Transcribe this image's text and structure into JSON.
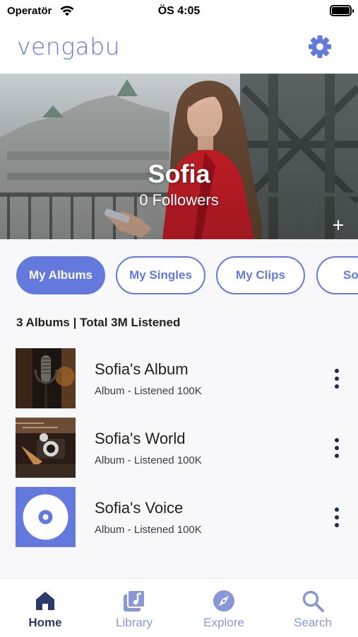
{
  "status_bar": {
    "carrier": "Operatör",
    "time": "ÖS 4:05",
    "wifi_icon": "wifi-icon",
    "battery_icon": "battery-icon"
  },
  "header": {
    "logo": "vengabu",
    "settings_icon": "gear-icon"
  },
  "profile": {
    "name": "Sofia",
    "followers": "0 Followers",
    "add_icon": "plus-icon"
  },
  "tabs": [
    {
      "label": "My Albums",
      "active": true
    },
    {
      "label": "My Singles",
      "active": false
    },
    {
      "label": "My Clips",
      "active": false
    },
    {
      "label": "So",
      "active": false
    }
  ],
  "summary": "3 Albums | Total 3M Listened",
  "albums": [
    {
      "title": "Sofia's Album",
      "meta": "Album  -  Listened 100K",
      "cover": "studio-microphone"
    },
    {
      "title": "Sofia's World",
      "meta": "Album  -  Listened 100K",
      "cover": "vintage-camera"
    },
    {
      "title": "Sofia's Voice",
      "meta": "Album  -  Listened 100K",
      "cover": "disc-icon"
    }
  ],
  "bottom_nav": [
    {
      "label": "Home",
      "icon": "home-icon",
      "current": true
    },
    {
      "label": "Library",
      "icon": "library-icon",
      "current": false
    },
    {
      "label": "Explore",
      "icon": "compass-icon",
      "current": false
    },
    {
      "label": "Search",
      "icon": "search-icon",
      "current": false
    }
  ],
  "colors": {
    "accent": "#6479dd",
    "nav_active": "#2b3a6b",
    "nav_inactive": "#8a97d6",
    "hero_jacket": "#d61f2a"
  }
}
